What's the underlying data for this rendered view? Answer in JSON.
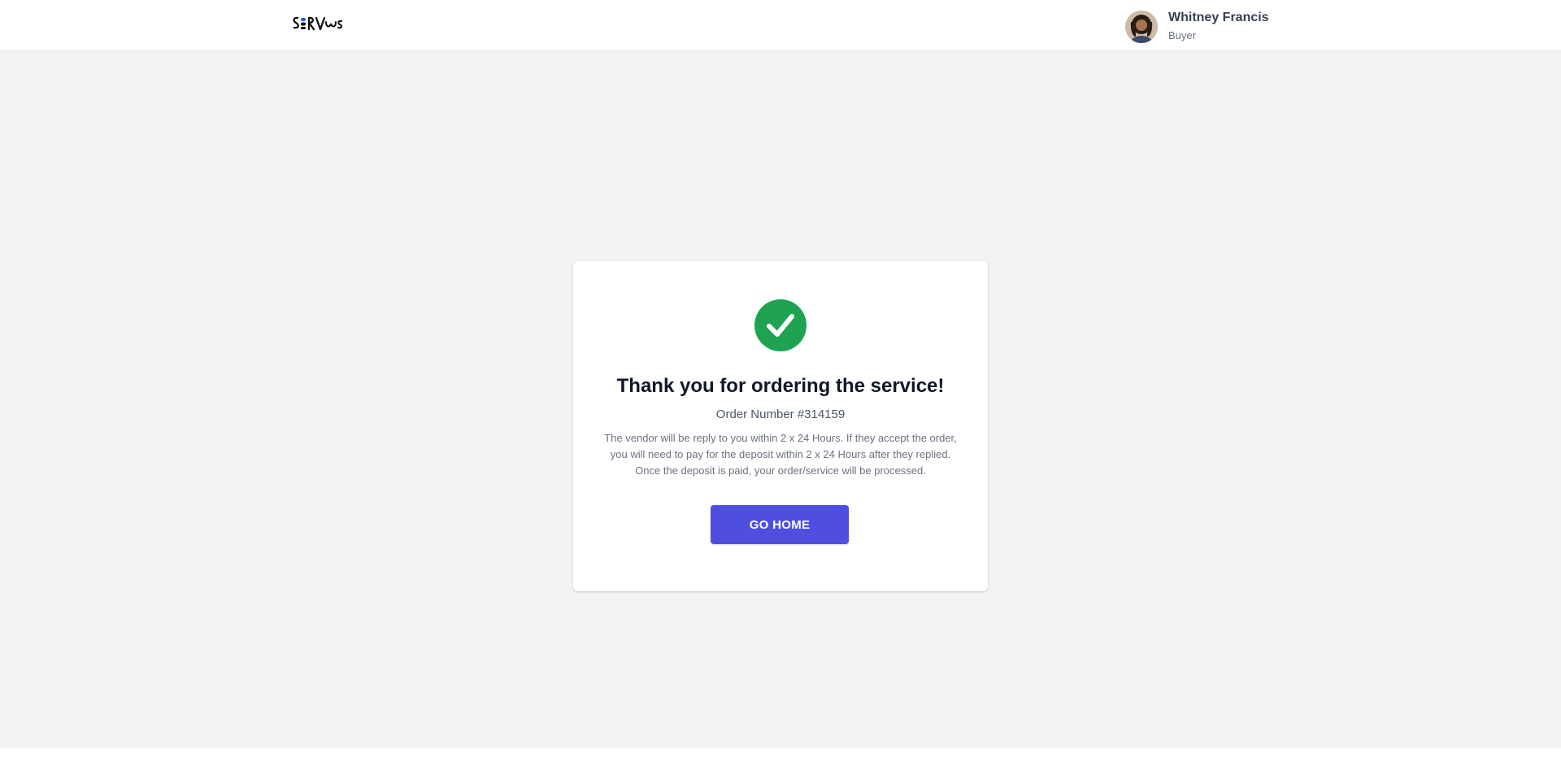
{
  "header": {
    "logo_text": "SERVus",
    "user": {
      "name": "Whitney Francis",
      "role": "Buyer"
    }
  },
  "confirmation": {
    "title": "Thank you for ordering the service!",
    "order_number": "Order Number #314159",
    "description": "The vendor will be reply to you within 2 x 24 Hours. If they accept the order, you will need to pay for the deposit within 2 x 24 Hours after they replied. Once the deposit is paid, your order/service will be processed.",
    "button_label": "GO HOME",
    "icon": "check-circle-icon"
  },
  "colors": {
    "accent": "#4f4fdf",
    "success": "#1fa351",
    "background": "#f2f3f5",
    "logo_dot": "#2563eb"
  }
}
